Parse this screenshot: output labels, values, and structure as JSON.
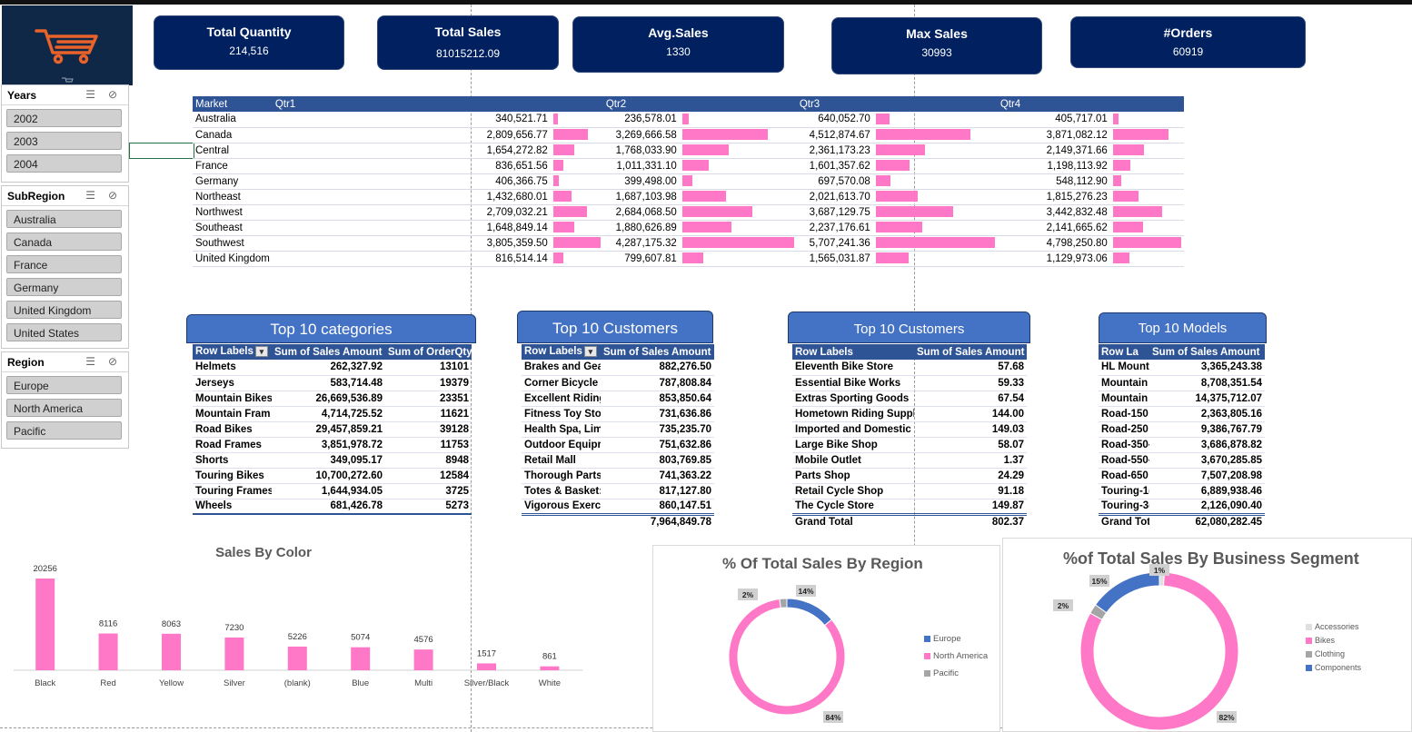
{
  "logo": {
    "icon": "shopping-cart-icon",
    "color": "#e8622a"
  },
  "kpis": [
    {
      "title": "Total Quantity",
      "value": "214,516"
    },
    {
      "title": "Total Sales",
      "value": "81015212.09"
    },
    {
      "title": "Avg.Sales",
      "value": "1330"
    },
    {
      "title": "Max Sales",
      "value": "30993"
    },
    {
      "title": "#Orders",
      "value": "60919"
    }
  ],
  "slicers": {
    "years": {
      "title": "Years",
      "items": [
        "2002",
        "2003",
        "2004"
      ]
    },
    "subregion": {
      "title": "SubRegion",
      "items": [
        "Australia",
        "Canada",
        "France",
        "Germany",
        "United Kingdom",
        "United States"
      ]
    },
    "region": {
      "title": "Region",
      "items": [
        "Europe",
        "North America",
        "Pacific"
      ]
    }
  },
  "market_table": {
    "headers": [
      "Market",
      "Qtr1",
      "Qtr2",
      "Qtr3",
      "Qtr4"
    ],
    "bar_color": "#ff78c8",
    "rows": [
      {
        "market": "Australia",
        "q1": "340,521.71",
        "q2": "236,578.01",
        "q3": "640,052.70",
        "q4": "405,717.01",
        "v": [
          340521.71,
          236578.01,
          640052.7,
          405717.01
        ]
      },
      {
        "market": "Canada",
        "q1": "2,809,656.77",
        "q2": "3,269,666.58",
        "q3": "4,512,874.67",
        "q4": "3,871,082.12",
        "v": [
          2809656.77,
          3269666.58,
          4512874.67,
          3871082.12
        ]
      },
      {
        "market": "Central",
        "q1": "1,654,272.82",
        "q2": "1,768,033.90",
        "q3": "2,361,173.23",
        "q4": "2,149,371.66",
        "v": [
          1654272.82,
          1768033.9,
          2361173.23,
          2149371.66
        ]
      },
      {
        "market": "France",
        "q1": "836,651.56",
        "q2": "1,011,331.10",
        "q3": "1,601,357.62",
        "q4": "1,198,113.92",
        "v": [
          836651.56,
          1011331.1,
          1601357.62,
          1198113.92
        ]
      },
      {
        "market": "Germany",
        "q1": "406,366.75",
        "q2": "399,498.00",
        "q3": "697,570.08",
        "q4": "548,112.90",
        "v": [
          406366.75,
          399498.0,
          697570.08,
          548112.9
        ]
      },
      {
        "market": "Northeast",
        "q1": "1,432,680.01",
        "q2": "1,687,103.98",
        "q3": "2,021,613.70",
        "q4": "1,815,276.23",
        "v": [
          1432680.01,
          1687103.98,
          2021613.7,
          1815276.23
        ]
      },
      {
        "market": "Northwest",
        "q1": "2,709,032.21",
        "q2": "2,684,068.50",
        "q3": "3,687,129.75",
        "q4": "3,442,832.48",
        "v": [
          2709032.21,
          2684068.5,
          3687129.75,
          3442832.48
        ]
      },
      {
        "market": "Southeast",
        "q1": "1,648,849.14",
        "q2": "1,880,626.89",
        "q3": "2,237,176.61",
        "q4": "2,141,665.62",
        "v": [
          1648849.14,
          1880626.89,
          2237176.61,
          2141665.62
        ]
      },
      {
        "market": "Southwest",
        "q1": "3,805,359.50",
        "q2": "4,287,175.32",
        "q3": "5,707,241.36",
        "q4": "4,798,250.80",
        "v": [
          3805359.5,
          4287175.32,
          5707241.36,
          4798250.8
        ]
      },
      {
        "market": "United Kingdom",
        "q1": "816,514.14",
        "q2": "799,607.81",
        "q3": "1,565,031.87",
        "q4": "1,129,973.06",
        "v": [
          816514.14,
          799607.81,
          1565031.87,
          1129973.06
        ]
      }
    ]
  },
  "top_categories": {
    "title": "Top 10 categories",
    "headers": [
      "Row Labels",
      "Sum of Sales Amount",
      "Sum of OrderQty"
    ],
    "rows": [
      [
        "Helmets",
        "262,327.92",
        "13101"
      ],
      [
        "Jerseys",
        "583,714.48",
        "19379"
      ],
      [
        "Mountain Bikes",
        "26,669,536.89",
        "23351"
      ],
      [
        "Mountain Fram",
        "4,714,725.52",
        "11621"
      ],
      [
        "Road Bikes",
        "29,457,859.21",
        "39128"
      ],
      [
        "Road Frames",
        "3,851,978.72",
        "11753"
      ],
      [
        "Shorts",
        "349,095.17",
        "8948"
      ],
      [
        "Touring Bikes",
        "10,700,272.60",
        "12584"
      ],
      [
        "Touring Frames",
        "1,644,934.05",
        "3725"
      ],
      [
        "Wheels",
        "681,426.78",
        "5273"
      ]
    ]
  },
  "top_customers_1": {
    "title": "Top 10 Customers",
    "headers": [
      "Row Labels",
      "Sum of Sales Amount"
    ],
    "rows": [
      [
        "Brakes and Gea",
        "882,276.50"
      ],
      [
        "Corner Bicycle S",
        "787,808.84"
      ],
      [
        "Excellent Riding",
        "853,850.64"
      ],
      [
        "Fitness Toy Stor",
        "731,636.86"
      ],
      [
        "Health Spa, Lim",
        "735,235.70"
      ],
      [
        "Outdoor Equipr",
        "751,632.86"
      ],
      [
        "Retail Mall",
        "803,769.85"
      ],
      [
        "Thorough Parts",
        "741,363.22"
      ],
      [
        "Totes & Basket:",
        "817,127.80"
      ],
      [
        "Vigorous Exerci",
        "860,147.51"
      ]
    ],
    "total_label": "",
    "total": "7,964,849.78"
  },
  "top_customers_2": {
    "title": "Top 10 Customers",
    "headers": [
      "Row Labels",
      "Sum of Sales Amount"
    ],
    "rows": [
      [
        "Eleventh Bike Store",
        "57.68"
      ],
      [
        "Essential Bike Works",
        "59.33"
      ],
      [
        "Extras Sporting Goods",
        "67.54"
      ],
      [
        "Hometown Riding Suppl",
        "144.00"
      ],
      [
        "Imported and Domestic",
        "149.03"
      ],
      [
        "Large Bike Shop",
        "58.07"
      ],
      [
        "Mobile Outlet",
        "1.37"
      ],
      [
        "Parts Shop",
        "24.29"
      ],
      [
        "Retail Cycle Shop",
        "91.18"
      ],
      [
        "The Cycle Store",
        "149.87"
      ]
    ],
    "total_label": "Grand Total",
    "total": "802.37"
  },
  "top_models": {
    "title": "Top 10 Models",
    "headers": [
      "Row La",
      "Sum of Sales Amount"
    ],
    "rows": [
      [
        "HL Mount",
        "3,365,243.38"
      ],
      [
        "Mountain",
        "8,708,351.54"
      ],
      [
        "Mountain",
        "14,375,712.07"
      ],
      [
        "Road-150",
        "2,363,805.16"
      ],
      [
        "Road-250",
        "9,386,767.79"
      ],
      [
        "Road-350-",
        "3,686,878.82"
      ],
      [
        "Road-550-",
        "3,670,285.85"
      ],
      [
        "Road-650",
        "7,507,208.98"
      ],
      [
        "Touring-1(",
        "6,889,938.46"
      ],
      [
        "Touring-3(",
        "2,126,090.40"
      ]
    ],
    "total_label": "Grand Tot",
    "total": "62,080,282.45"
  },
  "chart_data": [
    {
      "type": "bar",
      "title": "Sales By Color",
      "categories": [
        "Black",
        "Red",
        "Yellow",
        "Silver",
        "(blank)",
        "Blue",
        "Multi",
        "Silver/Black",
        "White"
      ],
      "values": [
        20256,
        8116,
        8063,
        7230,
        5226,
        5074,
        4576,
        1517,
        861
      ],
      "color": "#ff78c8",
      "xlabel": "",
      "ylabel": "",
      "ylim": [
        0,
        20256
      ]
    },
    {
      "type": "pie",
      "title": "% Of Total Sales By Region",
      "categories": [
        "Europe",
        "North America",
        "Pacific"
      ],
      "values": [
        14,
        84,
        2
      ],
      "labels": [
        "14%",
        "84%",
        "2%"
      ],
      "colors": [
        "#4472c4",
        "#ff78c8",
        "#a5a5a5"
      ],
      "legend": "right"
    },
    {
      "type": "pie",
      "title": "%of Total Sales By Business Segment",
      "categories": [
        "Accessories",
        "Bikes",
        "Clothing",
        "Components"
      ],
      "values": [
        1,
        82,
        2,
        15
      ],
      "labels": [
        "1%",
        "82%",
        "2%",
        "15%"
      ],
      "colors": [
        "#e0e0e0",
        "#ff78c8",
        "#a5a5a5",
        "#4472c4"
      ],
      "legend": "right"
    }
  ]
}
